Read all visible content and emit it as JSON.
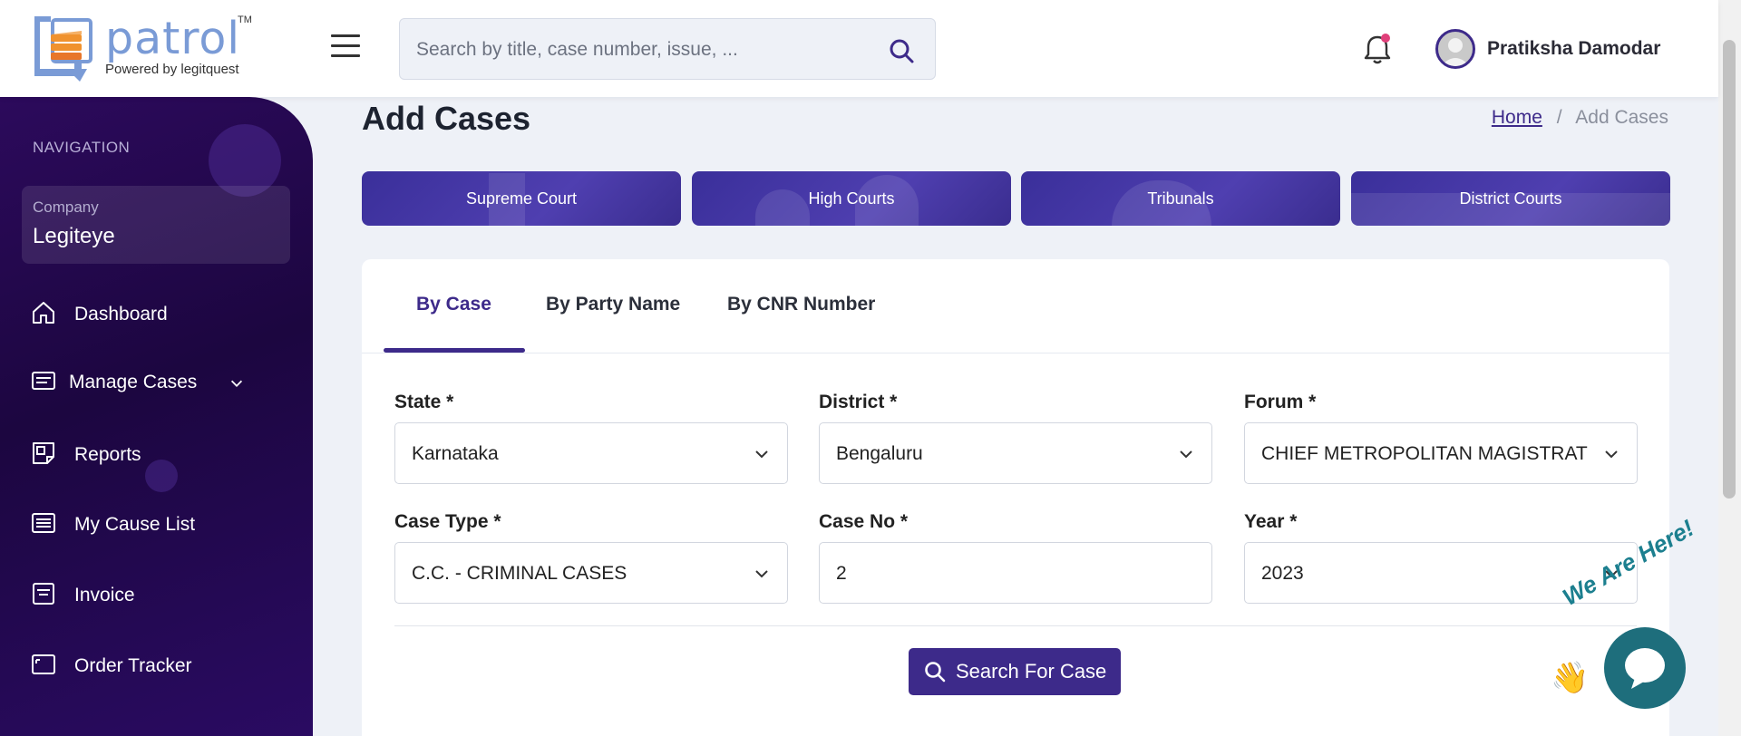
{
  "brand": {
    "name": "patrol",
    "trademark": "TM",
    "tagline": "Powered by legitquest",
    "accent": "#3d2a8a",
    "logo_color": "#7a9bd6"
  },
  "header": {
    "search_placeholder": "Search by title, case number, issue, ...",
    "user_name": "Pratiksha Damodar",
    "notification_dot_color": "#e0407a"
  },
  "sidebar": {
    "heading": "NAVIGATION",
    "company_label": "Company",
    "company_name": "Legiteye",
    "items": [
      {
        "label": "Dashboard",
        "icon": "home-icon"
      },
      {
        "label": "Manage Cases",
        "icon": "list-icon",
        "has_submenu": true
      },
      {
        "label": "Reports",
        "icon": "reports-icon"
      },
      {
        "label": "My Cause List",
        "icon": "cause-list-icon"
      },
      {
        "label": "Invoice",
        "icon": "invoice-icon"
      },
      {
        "label": "Order Tracker",
        "icon": "tracker-icon"
      }
    ]
  },
  "page": {
    "title": "Add Cases",
    "breadcrumb": {
      "home": "Home",
      "separator": "/",
      "current": "Add Cases"
    }
  },
  "court_tabs": [
    "Supreme Court",
    "High Courts",
    "Tribunals",
    "District Courts"
  ],
  "search_tabs": {
    "items": [
      "By Case",
      "By Party Name",
      "By CNR Number"
    ],
    "active": "By Case"
  },
  "form": {
    "state": {
      "label": "State *",
      "value": "Karnataka"
    },
    "district": {
      "label": "District *",
      "value": "Bengaluru"
    },
    "forum": {
      "label": "Forum *",
      "value": "CHIEF METROPOLITAN MAGISTRAT"
    },
    "case_type": {
      "label": "Case Type *",
      "value": "C.C. - CRIMINAL CASES"
    },
    "case_no": {
      "label": "Case No *",
      "value": "2"
    },
    "year": {
      "label": "Year *",
      "value": "2023"
    },
    "submit_label": "Search For Case"
  },
  "chat": {
    "badge_text": "We Are Here!",
    "wave": "👋",
    "color": "#1e6e7c"
  }
}
